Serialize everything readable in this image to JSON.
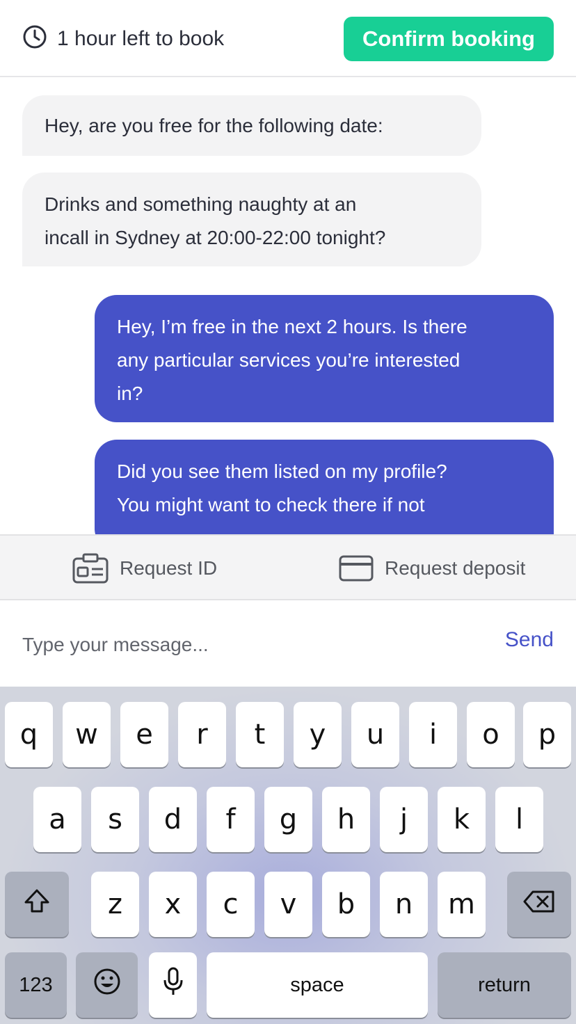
{
  "header": {
    "timer_text": "1 hour left to book",
    "confirm_label": "Confirm booking"
  },
  "messages": [
    {
      "direction": "incoming",
      "lines": [
        "Hey, are you free for the following date:"
      ]
    },
    {
      "direction": "incoming",
      "lines": [
        "Drinks and something naughty at an",
        "incall in Sydney at 20:00-22:00 tonight?"
      ]
    },
    {
      "direction": "outgoing",
      "lines": [
        "Hey, I’m free in the next 2 hours. Is there",
        "any particular services you’re interested",
        "in?"
      ]
    },
    {
      "direction": "outgoing",
      "lines": [
        "Did you see them listed on my profile?",
        "You might want to check there if not"
      ]
    }
  ],
  "actions": {
    "request_id": "Request ID",
    "request_deposit": "Request deposit"
  },
  "composer": {
    "placeholder": "Type your message...",
    "send_label": "Send"
  },
  "keyboard": {
    "row1": [
      "q",
      "w",
      "e",
      "r",
      "t",
      "y",
      "u",
      "i",
      "o",
      "p"
    ],
    "row2": [
      "a",
      "s",
      "d",
      "f",
      "g",
      "h",
      "j",
      "k",
      "l"
    ],
    "row3": [
      "z",
      "x",
      "c",
      "v",
      "b",
      "n",
      "m"
    ],
    "numbers_label": "123",
    "space_label": "space",
    "return_label": "return"
  },
  "colors": {
    "accent_green": "#18cf95",
    "outgoing_bubble": "#4652c8",
    "incoming_bubble": "#f3f3f4"
  }
}
